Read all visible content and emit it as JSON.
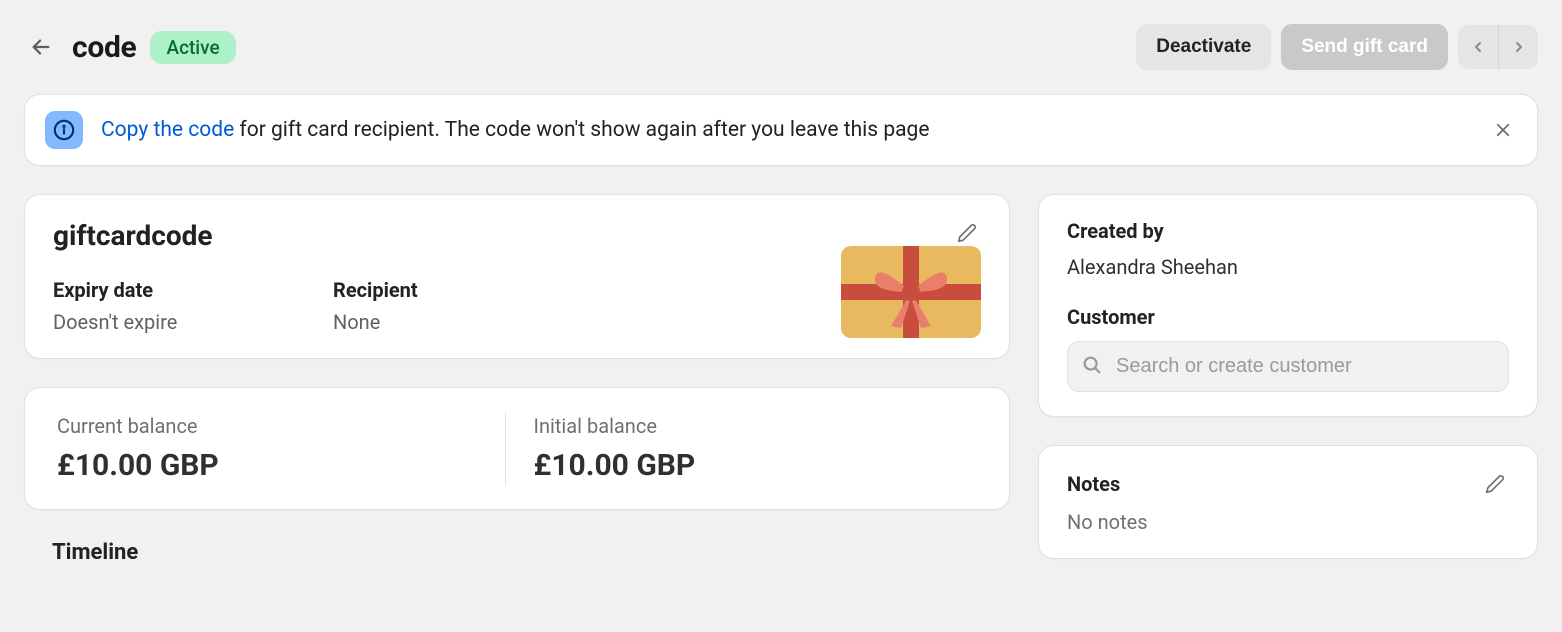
{
  "header": {
    "title": "code",
    "status": "Active",
    "deactivate_label": "Deactivate",
    "send_label": "Send gift card"
  },
  "banner": {
    "link_text": "Copy the code",
    "rest_text": " for gift card recipient. The code won't show again after you leave this page"
  },
  "giftcard": {
    "code": "giftcardcode",
    "expiry_label": "Expiry date",
    "expiry_value": "Doesn't expire",
    "recipient_label": "Recipient",
    "recipient_value": "None"
  },
  "balances": {
    "current_label": "Current balance",
    "current_value": "£10.00 GBP",
    "initial_label": "Initial balance",
    "initial_value": "£10.00 GBP"
  },
  "timeline": {
    "heading": "Timeline"
  },
  "sidebar": {
    "created_by_label": "Created by",
    "created_by_value": "Alexandra Sheehan",
    "customer_label": "Customer",
    "customer_placeholder": "Search or create customer",
    "notes_label": "Notes",
    "notes_value": "No notes"
  }
}
